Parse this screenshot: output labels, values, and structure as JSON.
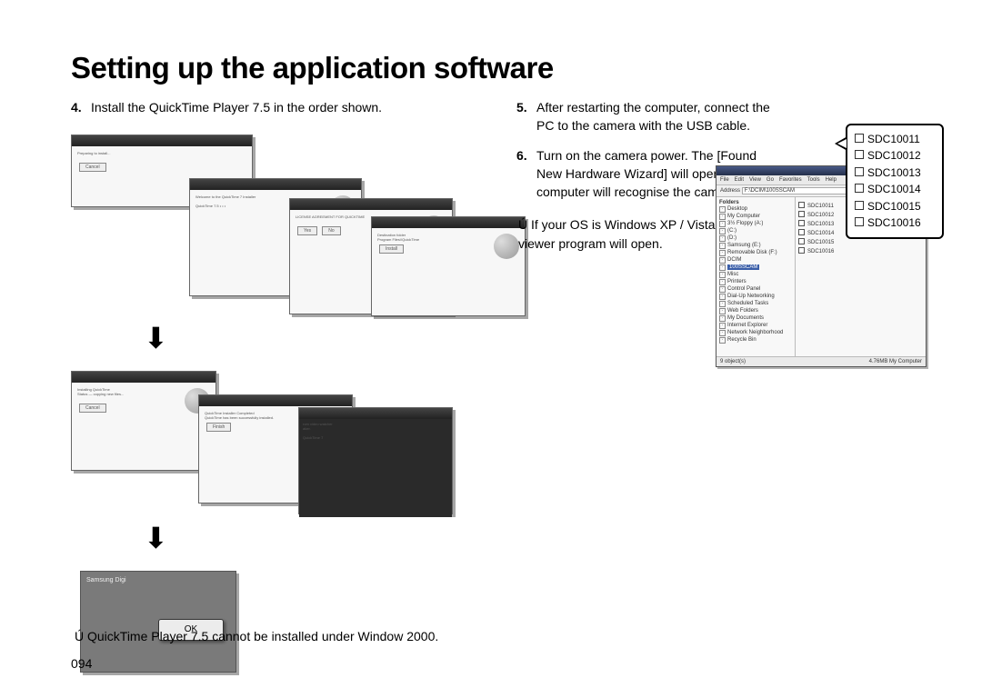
{
  "page": {
    "title": "Setting up the application software",
    "number": "094"
  },
  "left": {
    "step4_num": "4.",
    "step4_text": "Install the QuickTime Player 7.5 in the order shown.",
    "footnote_mark": "Ú",
    "footnote": "QuickTime Player 7.5 cannot be installed under Window 2000.",
    "ok_label": "OK",
    "brand": "Samsung Digi"
  },
  "right": {
    "step5_num": "5.",
    "step5_text": "After restarting the computer, connect the PC to the camera with the USB cable.",
    "step6_num": "6.",
    "step6_text": "Turn on the camera power. The [Found New Hardware Wizard] will open and the computer will recognise the camera.",
    "note_mark": "Ú",
    "note_text": "If your OS is Windows XP / Vista, an image viewer program will open."
  },
  "explorer": {
    "menu": [
      "File",
      "Edit",
      "View",
      "Go",
      "Favorites",
      "Tools",
      "Help"
    ],
    "addr_label": "Address",
    "addr_value": "F:\\DCIM\\100SSCAM",
    "tree_header": "Folders",
    "tree": [
      {
        "label": "Desktop"
      },
      {
        "label": "My Computer"
      },
      {
        "label": "3½ Floppy (A:)"
      },
      {
        "label": "(C:)"
      },
      {
        "label": "(D:)"
      },
      {
        "label": "Samsung (E:)"
      },
      {
        "label": "Removable Disk (F:)"
      },
      {
        "label": "DCIM"
      },
      {
        "label": "100SSCAM",
        "selected": true
      },
      {
        "label": "Misc"
      },
      {
        "label": "Printers"
      },
      {
        "label": "Control Panel"
      },
      {
        "label": "Dial-Up Networking"
      },
      {
        "label": "Scheduled Tasks"
      },
      {
        "label": "Web Folders"
      },
      {
        "label": "My Documents"
      },
      {
        "label": "Internet Explorer"
      },
      {
        "label": "Network Neighborhood"
      },
      {
        "label": "Recycle Bin"
      }
    ],
    "files": [
      "SDC10011",
      "SDC10012",
      "SDC10013",
      "SDC10014",
      "SDC10015",
      "SDC10016"
    ],
    "status_left": "9 object(s)",
    "status_right": "4.76MB  My Computer"
  },
  "popup": {
    "items": [
      "SDC10011",
      "SDC10012",
      "SDC10013",
      "SDC10014",
      "SDC10015",
      "SDC10016"
    ]
  }
}
